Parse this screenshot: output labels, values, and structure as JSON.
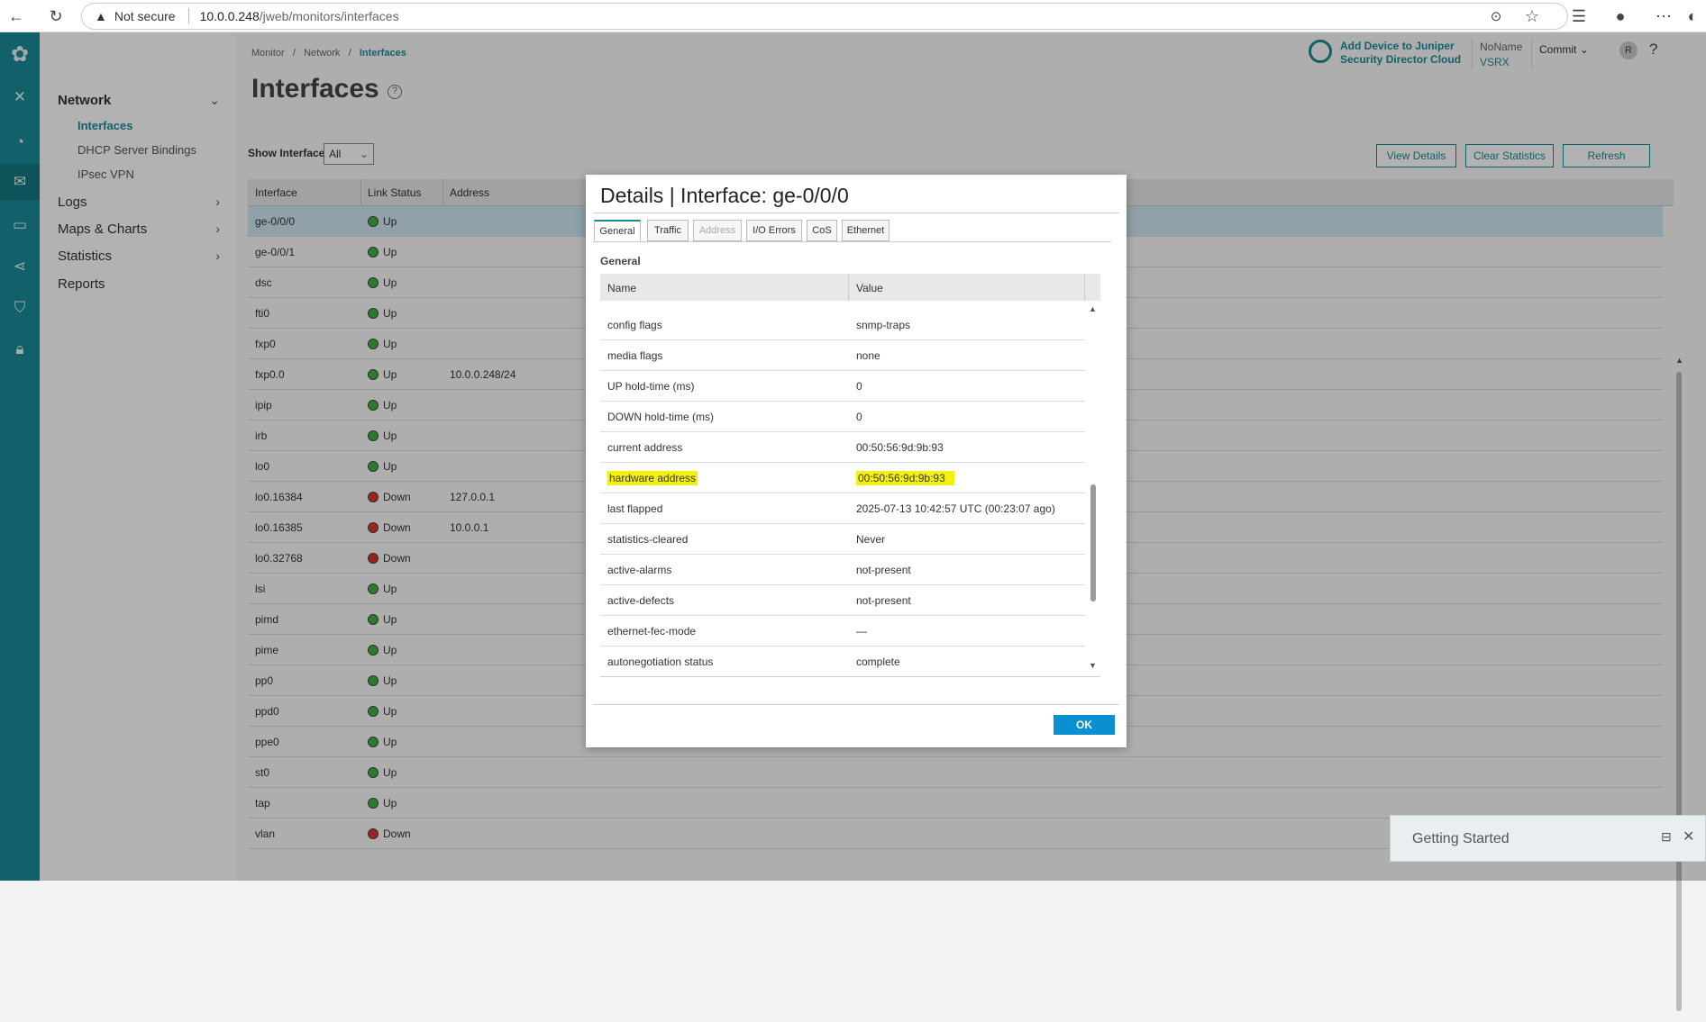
{
  "browser": {
    "security": "Not secure",
    "url_host": "10.0.0.248",
    "url_path": "/jweb/monitors/interfaces"
  },
  "header": {
    "promo_line1": "Add Device to Juniper",
    "promo_line2": "Security Director Cloud",
    "device_name": "NoName",
    "device_model": "VSRX",
    "commit_label": "Commit",
    "user_initial": "R",
    "help": "?"
  },
  "breadcrumb": [
    "Monitor",
    "Network",
    "Interfaces"
  ],
  "page_title": "Interfaces",
  "sidebar": {
    "section": "Network",
    "sub_items": [
      "Interfaces",
      "DHCP Server Bindings",
      "IPsec VPN"
    ],
    "items": [
      "Logs",
      "Maps & Charts",
      "Statistics",
      "Reports"
    ]
  },
  "toolbar": {
    "show_label": "Show Interfaces",
    "show_value": "All",
    "view_details": "View Details",
    "clear_statistics": "Clear Statistics",
    "refresh": "Refresh"
  },
  "table": {
    "columns": [
      "Interface",
      "Link Status",
      "Address"
    ],
    "rows": [
      {
        "name": "ge-0/0/0",
        "status": "Up",
        "address": ""
      },
      {
        "name": "ge-0/0/1",
        "status": "Up",
        "address": ""
      },
      {
        "name": "dsc",
        "status": "Up",
        "address": ""
      },
      {
        "name": "fti0",
        "status": "Up",
        "address": ""
      },
      {
        "name": "fxp0",
        "status": "Up",
        "address": ""
      },
      {
        "name": "fxp0.0",
        "status": "Up",
        "address": "10.0.0.248/24"
      },
      {
        "name": "ipip",
        "status": "Up",
        "address": ""
      },
      {
        "name": "irb",
        "status": "Up",
        "address": ""
      },
      {
        "name": "lo0",
        "status": "Up",
        "address": ""
      },
      {
        "name": "lo0.16384",
        "status": "Down",
        "address": "127.0.0.1"
      },
      {
        "name": "lo0.16385",
        "status": "Down",
        "address": "10.0.0.1"
      },
      {
        "name": "lo0.32768",
        "status": "Down",
        "address": ""
      },
      {
        "name": "lsi",
        "status": "Up",
        "address": ""
      },
      {
        "name": "pimd",
        "status": "Up",
        "address": ""
      },
      {
        "name": "pime",
        "status": "Up",
        "address": ""
      },
      {
        "name": "pp0",
        "status": "Up",
        "address": ""
      },
      {
        "name": "ppd0",
        "status": "Up",
        "address": ""
      },
      {
        "name": "ppe0",
        "status": "Up",
        "address": ""
      },
      {
        "name": "st0",
        "status": "Up",
        "address": ""
      },
      {
        "name": "tap",
        "status": "Up",
        "address": ""
      },
      {
        "name": "vlan",
        "status": "Down",
        "address": ""
      }
    ]
  },
  "modal": {
    "title": "Details | Interface: ge-0/0/0",
    "tabs": [
      "General",
      "Traffic",
      "Address",
      "I/O Errors",
      "CoS",
      "Ethernet"
    ],
    "section": "General",
    "columns": [
      "Name",
      "Value"
    ],
    "rows": [
      {
        "name": "config flags",
        "value": "snmp-traps"
      },
      {
        "name": "media flags",
        "value": "none"
      },
      {
        "name": "UP hold-time (ms)",
        "value": "0"
      },
      {
        "name": "DOWN hold-time (ms)",
        "value": "0"
      },
      {
        "name": "current address",
        "value": "00:50:56:9d:9b:93"
      },
      {
        "name": "hardware address",
        "value": "00:50:56:9d:9b:93"
      },
      {
        "name": "last flapped",
        "value": "2025-07-13 10:42:57 UTC (00:23:07 ago)"
      },
      {
        "name": "statistics-cleared",
        "value": "Never"
      },
      {
        "name": "active-alarms",
        "value": "not-present"
      },
      {
        "name": "active-defects",
        "value": "not-present"
      },
      {
        "name": "ethernet-fec-mode",
        "value": "—"
      },
      {
        "name": "autonegotiation status",
        "value": "complete"
      }
    ],
    "ok_label": "OK"
  },
  "getting_started": "Getting Started",
  "colors": {
    "accent": "#1b8a97",
    "up": "#3fb03f",
    "down": "#d9342b",
    "highlight": "#f5f20a"
  }
}
